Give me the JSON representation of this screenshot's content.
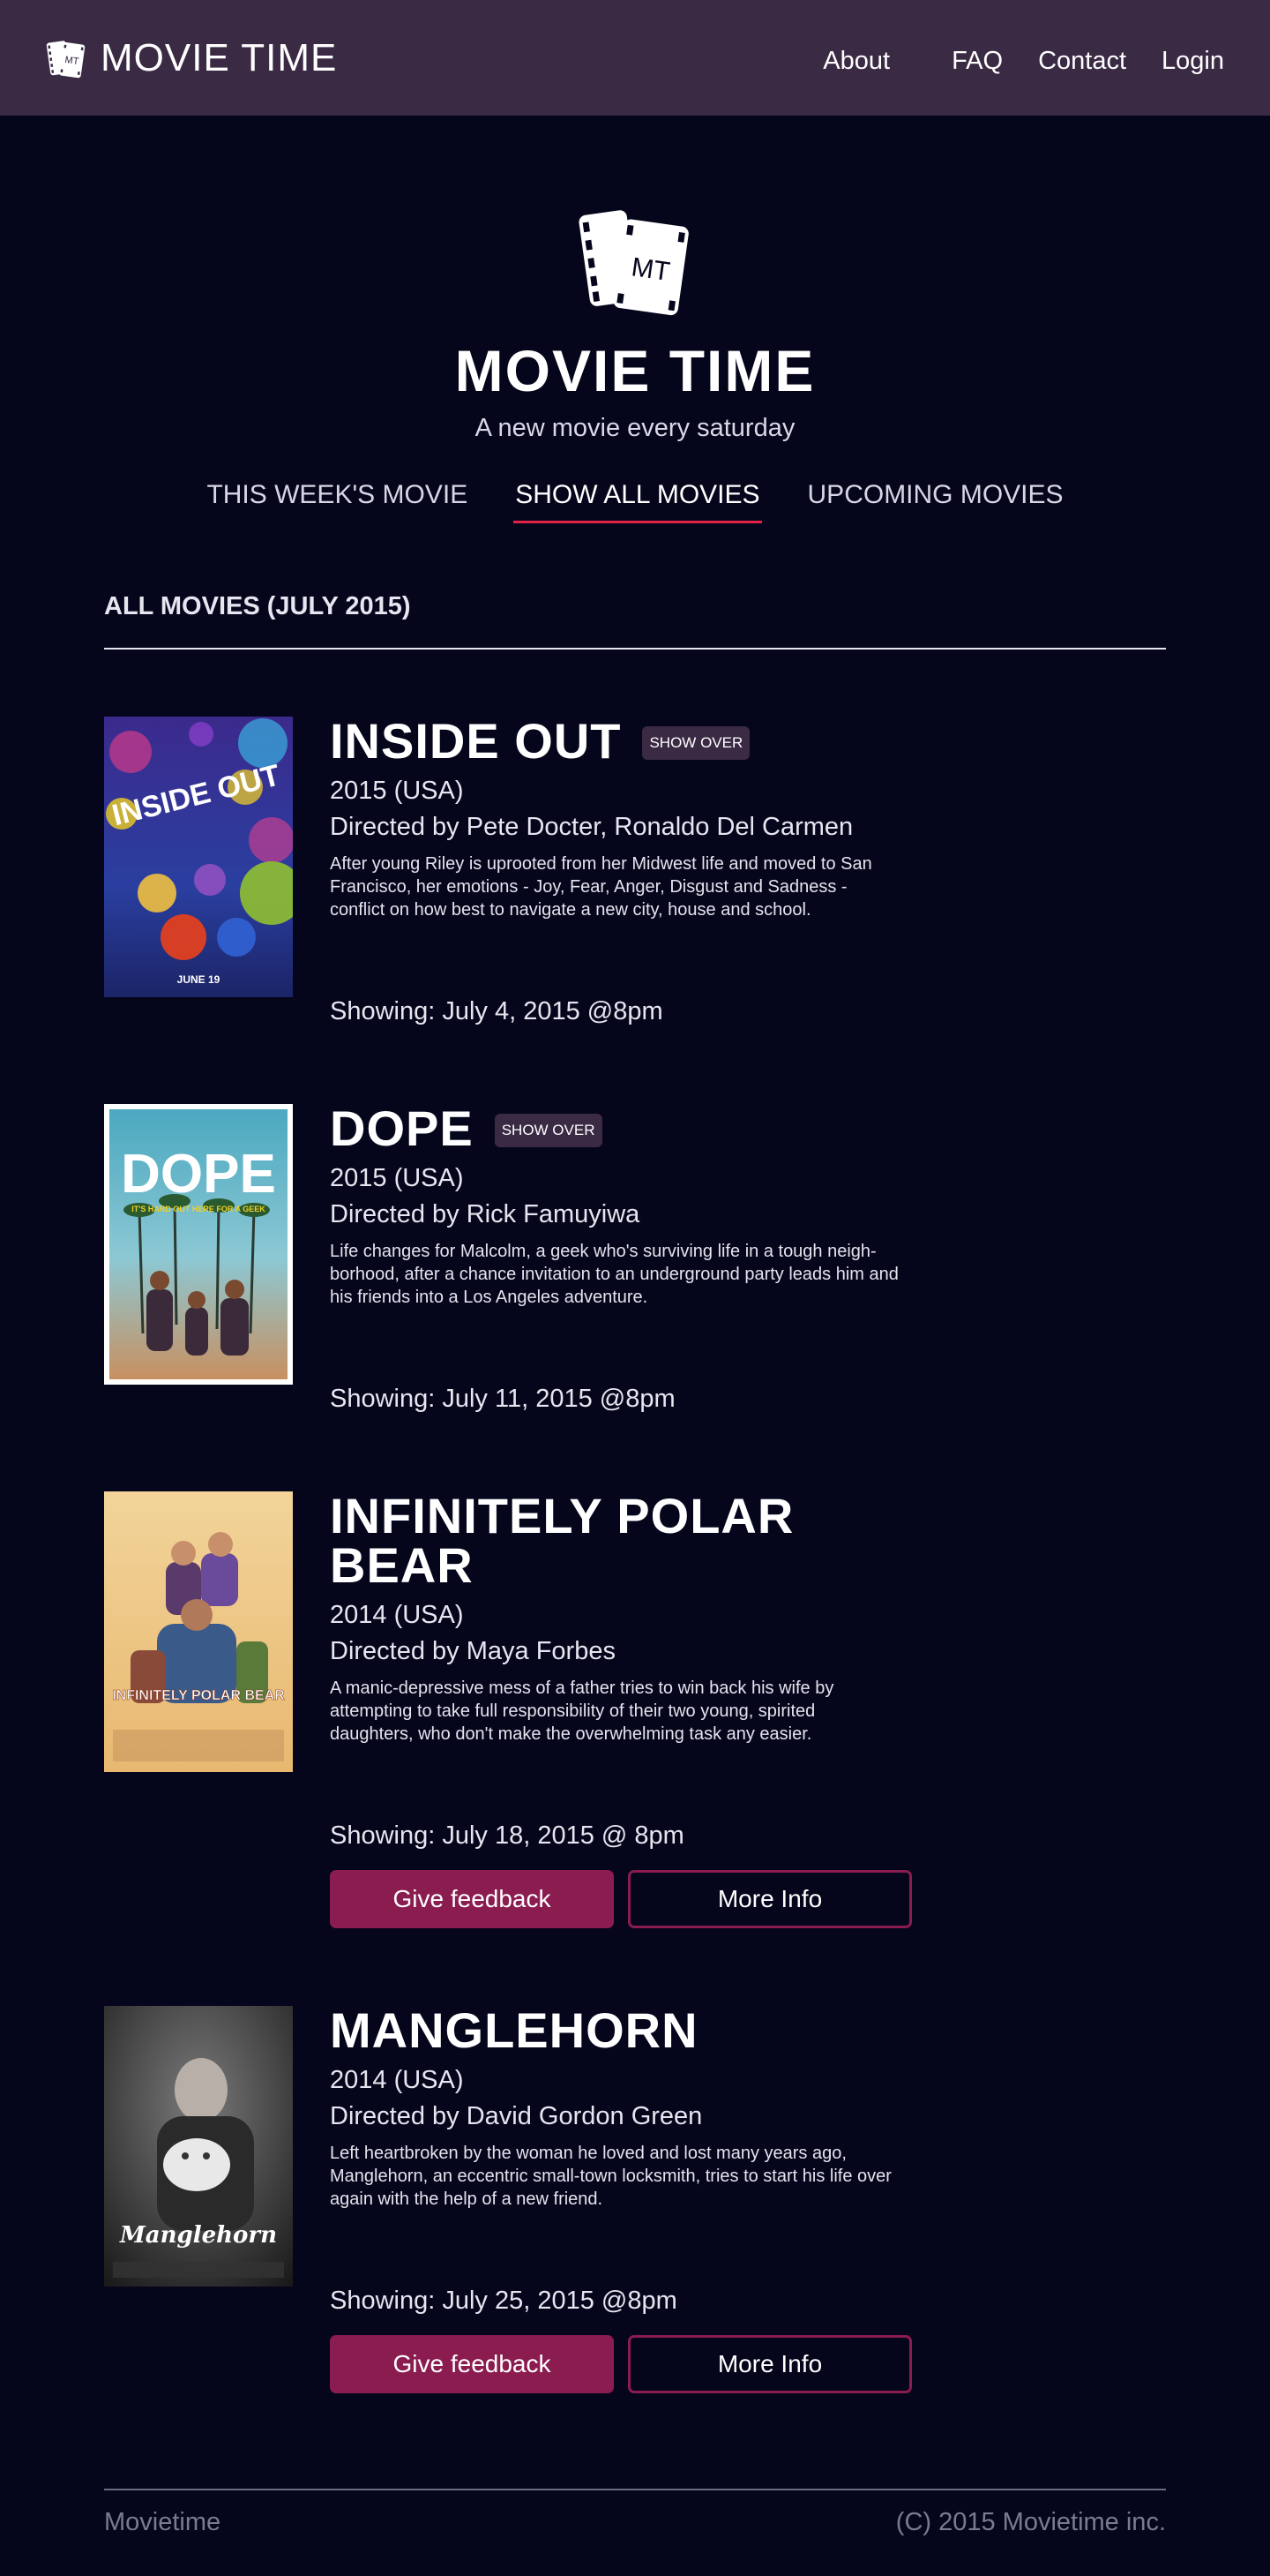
{
  "header": {
    "brand_name": "MOVIE TIME",
    "logo_text": "MT",
    "nav": [
      {
        "label": "About"
      },
      {
        "label": "FAQ"
      },
      {
        "label": "Contact"
      },
      {
        "label": "Login"
      }
    ]
  },
  "hero": {
    "logo_text": "MT",
    "title": "MOVIE TIME",
    "tagline": "A new movie every saturday"
  },
  "tabs": [
    {
      "label": "THIS WEEK'S MOVIE",
      "active": false
    },
    {
      "label": "SHOW ALL MOVIES",
      "active": true
    },
    {
      "label": "UPCOMING MOVIES",
      "active": false
    }
  ],
  "section": {
    "heading": "ALL MOVIES (JULY 2015)"
  },
  "movies": [
    {
      "title": "INSIDE OUT",
      "badge": "SHOW OVER",
      "year": "2015 (USA)",
      "director": "Directed by Pete Docter, Ronaldo Del Carmen",
      "synopsis": "After young Riley is uprooted from her Midwest life and moved to San Francisco, her emotions - Joy, Fear, Anger, Disgust and Sadness - conflict on how best to navigate a new city, house and school.",
      "showing": "Showing: July 4, 2015 @8pm",
      "poster_text": "INSIDE OUT",
      "poster_sub": "JUNE 19"
    },
    {
      "title": "DOPE",
      "badge": "SHOW OVER",
      "year": "2015 (USA)",
      "director": "Directed by Rick Famuyiwa",
      "synopsis": "Life changes for Malcolm, a geek who's surviving life in a tough neigh-borhood, after a chance invitation to an underground party leads him and his friends into a Los Angeles adventure.",
      "showing": "Showing: July 11, 2015 @8pm",
      "poster_text": "DOPE",
      "poster_sub": "IT'S HARD OUT HERE FOR A GEEK"
    },
    {
      "title": "INFINITELY POLAR BEAR",
      "year": "2014 (USA)",
      "director": "Directed by Maya Forbes",
      "synopsis": "A manic-depressive mess of a father tries to win back his wife by attempting to take full responsibility of their two young, spirited daughters, who don't make the overwhelming task any easier.",
      "showing": "Showing: July 18, 2015 @ 8pm",
      "poster_text": "INFINITELY POLAR BEAR",
      "feedback_label": "Give feedback",
      "more_label": "More Info"
    },
    {
      "title": "MANGLEHORN",
      "year": "2014 (USA)",
      "director": "Directed by David Gordon Green",
      "synopsis": "Left heartbroken by the woman he loved and lost many years ago, Manglehorn, an eccentric small-town locksmith, tries to start his life over again with the help of a new friend.",
      "showing": "Showing: July 25, 2015 @8pm",
      "poster_text": "Manglehorn",
      "feedback_label": "Give feedback",
      "more_label": "More Info"
    }
  ],
  "footer": {
    "left": "Movietime",
    "right": "(C) 2015 Movietime inc."
  },
  "colors": {
    "background": "#05051c",
    "header": "#3a2a44",
    "accent": "#8a1c50",
    "tab_underline": "#e32248"
  }
}
